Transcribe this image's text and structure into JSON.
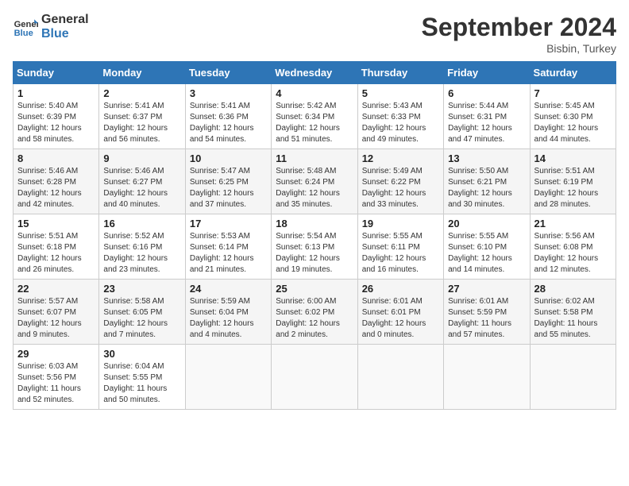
{
  "logo": {
    "line1": "General",
    "line2": "Blue"
  },
  "title": "September 2024",
  "location": "Bisbin, Turkey",
  "days_header": [
    "Sunday",
    "Monday",
    "Tuesday",
    "Wednesday",
    "Thursday",
    "Friday",
    "Saturday"
  ],
  "weeks": [
    [
      {
        "num": "1",
        "sunrise": "5:40 AM",
        "sunset": "6:39 PM",
        "daylight": "12 hours and 58 minutes."
      },
      {
        "num": "2",
        "sunrise": "5:41 AM",
        "sunset": "6:37 PM",
        "daylight": "12 hours and 56 minutes."
      },
      {
        "num": "3",
        "sunrise": "5:41 AM",
        "sunset": "6:36 PM",
        "daylight": "12 hours and 54 minutes."
      },
      {
        "num": "4",
        "sunrise": "5:42 AM",
        "sunset": "6:34 PM",
        "daylight": "12 hours and 51 minutes."
      },
      {
        "num": "5",
        "sunrise": "5:43 AM",
        "sunset": "6:33 PM",
        "daylight": "12 hours and 49 minutes."
      },
      {
        "num": "6",
        "sunrise": "5:44 AM",
        "sunset": "6:31 PM",
        "daylight": "12 hours and 47 minutes."
      },
      {
        "num": "7",
        "sunrise": "5:45 AM",
        "sunset": "6:30 PM",
        "daylight": "12 hours and 44 minutes."
      }
    ],
    [
      {
        "num": "8",
        "sunrise": "5:46 AM",
        "sunset": "6:28 PM",
        "daylight": "12 hours and 42 minutes."
      },
      {
        "num": "9",
        "sunrise": "5:46 AM",
        "sunset": "6:27 PM",
        "daylight": "12 hours and 40 minutes."
      },
      {
        "num": "10",
        "sunrise": "5:47 AM",
        "sunset": "6:25 PM",
        "daylight": "12 hours and 37 minutes."
      },
      {
        "num": "11",
        "sunrise": "5:48 AM",
        "sunset": "6:24 PM",
        "daylight": "12 hours and 35 minutes."
      },
      {
        "num": "12",
        "sunrise": "5:49 AM",
        "sunset": "6:22 PM",
        "daylight": "12 hours and 33 minutes."
      },
      {
        "num": "13",
        "sunrise": "5:50 AM",
        "sunset": "6:21 PM",
        "daylight": "12 hours and 30 minutes."
      },
      {
        "num": "14",
        "sunrise": "5:51 AM",
        "sunset": "6:19 PM",
        "daylight": "12 hours and 28 minutes."
      }
    ],
    [
      {
        "num": "15",
        "sunrise": "5:51 AM",
        "sunset": "6:18 PM",
        "daylight": "12 hours and 26 minutes."
      },
      {
        "num": "16",
        "sunrise": "5:52 AM",
        "sunset": "6:16 PM",
        "daylight": "12 hours and 23 minutes."
      },
      {
        "num": "17",
        "sunrise": "5:53 AM",
        "sunset": "6:14 PM",
        "daylight": "12 hours and 21 minutes."
      },
      {
        "num": "18",
        "sunrise": "5:54 AM",
        "sunset": "6:13 PM",
        "daylight": "12 hours and 19 minutes."
      },
      {
        "num": "19",
        "sunrise": "5:55 AM",
        "sunset": "6:11 PM",
        "daylight": "12 hours and 16 minutes."
      },
      {
        "num": "20",
        "sunrise": "5:55 AM",
        "sunset": "6:10 PM",
        "daylight": "12 hours and 14 minutes."
      },
      {
        "num": "21",
        "sunrise": "5:56 AM",
        "sunset": "6:08 PM",
        "daylight": "12 hours and 12 minutes."
      }
    ],
    [
      {
        "num": "22",
        "sunrise": "5:57 AM",
        "sunset": "6:07 PM",
        "daylight": "12 hours and 9 minutes."
      },
      {
        "num": "23",
        "sunrise": "5:58 AM",
        "sunset": "6:05 PM",
        "daylight": "12 hours and 7 minutes."
      },
      {
        "num": "24",
        "sunrise": "5:59 AM",
        "sunset": "6:04 PM",
        "daylight": "12 hours and 4 minutes."
      },
      {
        "num": "25",
        "sunrise": "6:00 AM",
        "sunset": "6:02 PM",
        "daylight": "12 hours and 2 minutes."
      },
      {
        "num": "26",
        "sunrise": "6:01 AM",
        "sunset": "6:01 PM",
        "daylight": "12 hours and 0 minutes."
      },
      {
        "num": "27",
        "sunrise": "6:01 AM",
        "sunset": "5:59 PM",
        "daylight": "11 hours and 57 minutes."
      },
      {
        "num": "28",
        "sunrise": "6:02 AM",
        "sunset": "5:58 PM",
        "daylight": "11 hours and 55 minutes."
      }
    ],
    [
      {
        "num": "29",
        "sunrise": "6:03 AM",
        "sunset": "5:56 PM",
        "daylight": "11 hours and 52 minutes."
      },
      {
        "num": "30",
        "sunrise": "6:04 AM",
        "sunset": "5:55 PM",
        "daylight": "11 hours and 50 minutes."
      },
      null,
      null,
      null,
      null,
      null
    ]
  ]
}
